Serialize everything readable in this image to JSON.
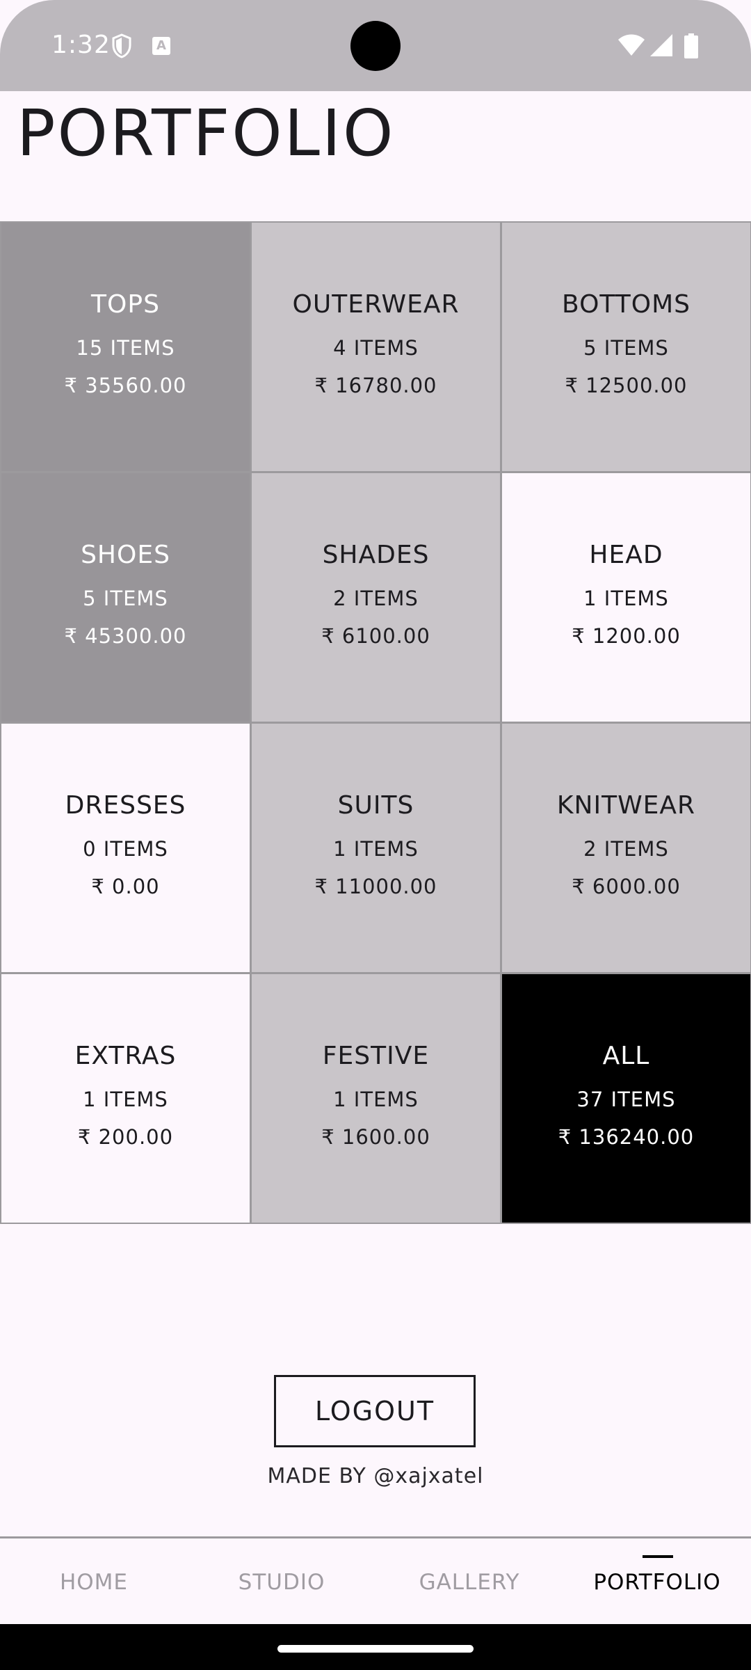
{
  "status_bar": {
    "time": "1:32",
    "a_badge": "A",
    "icons": [
      "shield-icon",
      "keyboard-a-icon",
      "wifi-icon",
      "cellular-signal-icon",
      "battery-icon"
    ],
    "background": "#bcb8bd"
  },
  "page": {
    "title": "PORTFOLIO"
  },
  "categories": [
    {
      "name": "TOPS",
      "count": "15 ITEMS",
      "price": "₹ 35560.00",
      "bg": "#989599",
      "fg": "#ffffff"
    },
    {
      "name": "OUTERWEAR",
      "count": "4 ITEMS",
      "price": "₹ 16780.00",
      "bg": "#c9c5c9",
      "fg": "#1c1b1f"
    },
    {
      "name": "BOTTOMS",
      "count": "5 ITEMS",
      "price": "₹ 12500.00",
      "bg": "#c9c5c9",
      "fg": "#1c1b1f"
    },
    {
      "name": "SHOES",
      "count": "5 ITEMS",
      "price": "₹ 45300.00",
      "bg": "#989599",
      "fg": "#ffffff"
    },
    {
      "name": "SHADES",
      "count": "2 ITEMS",
      "price": "₹ 6100.00",
      "bg": "#c9c5c9",
      "fg": "#1c1b1f"
    },
    {
      "name": "HEAD",
      "count": "1 ITEMS",
      "price": "₹ 1200.00",
      "bg": "#fdf7fd",
      "fg": "#1c1b1f"
    },
    {
      "name": "DRESSES",
      "count": "0 ITEMS",
      "price": "₹ 0.00",
      "bg": "#fdf7fd",
      "fg": "#1c1b1f"
    },
    {
      "name": "SUITS",
      "count": "1 ITEMS",
      "price": "₹ 11000.00",
      "bg": "#c9c5c9",
      "fg": "#1c1b1f"
    },
    {
      "name": "KNITWEAR",
      "count": "2 ITEMS",
      "price": "₹ 6000.00",
      "bg": "#c9c5c9",
      "fg": "#1c1b1f"
    },
    {
      "name": "EXTRAS",
      "count": "1 ITEMS",
      "price": "₹ 200.00",
      "bg": "#fdf7fd",
      "fg": "#1c1b1f"
    },
    {
      "name": "FESTIVE",
      "count": "1 ITEMS",
      "price": "₹ 1600.00",
      "bg": "#c9c5c9",
      "fg": "#1c1b1f"
    },
    {
      "name": "ALL",
      "count": "37 ITEMS",
      "price": "₹ 136240.00",
      "bg": "#000000",
      "fg": "#ffffff"
    }
  ],
  "logout": {
    "label": "LOGOUT"
  },
  "footer": {
    "made_by": "MADE BY @xajxatel"
  },
  "nav": {
    "items": [
      {
        "label": "HOME",
        "active": false
      },
      {
        "label": "STUDIO",
        "active": false
      },
      {
        "label": "GALLERY",
        "active": false
      },
      {
        "label": "PORTFOLIO",
        "active": true
      }
    ]
  }
}
